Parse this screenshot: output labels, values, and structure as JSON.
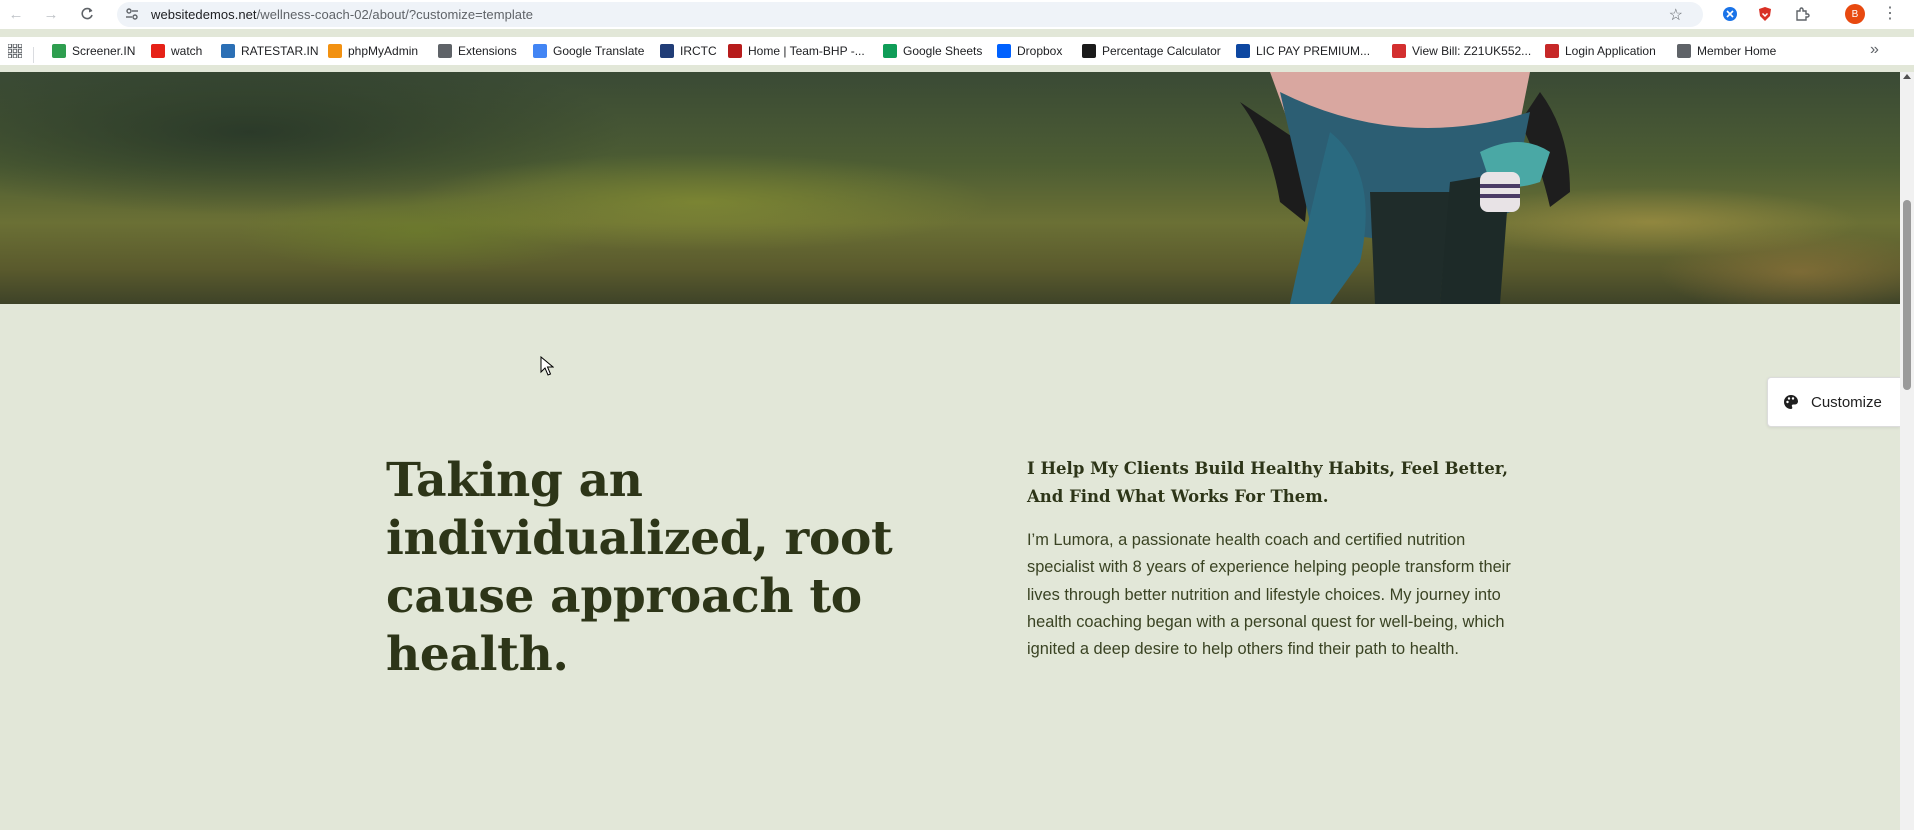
{
  "browser": {
    "url_host": "websitedemos.net",
    "url_path": "/wellness-coach-02/about/?customize=template",
    "avatar_letter": "B",
    "icons": [
      "back-icon",
      "forward-icon",
      "reload-icon",
      "site-settings-icon",
      "star-icon",
      "extension-icon",
      "menu-icon"
    ]
  },
  "bookmarks": [
    {
      "label": "Screener.IN",
      "color": "#2e9e4f"
    },
    {
      "label": "watch",
      "color": "#e62117"
    },
    {
      "label": "RATESTAR.IN",
      "color": "#2b6fb5"
    },
    {
      "label": "phpMyAdmin",
      "color": "#f29111"
    },
    {
      "label": "Extensions",
      "color": "#5f6368"
    },
    {
      "label": "Google Translate",
      "color": "#4285f4"
    },
    {
      "label": "IRCTC",
      "color": "#213d77"
    },
    {
      "label": "Home | Team-BHP -...",
      "color": "#b71c1c"
    },
    {
      "label": "Google Sheets",
      "color": "#0f9d58"
    },
    {
      "label": "Dropbox",
      "color": "#0061fe"
    },
    {
      "label": "Percentage Calculator",
      "color": "#1a1a1a"
    },
    {
      "label": "LIC PAY PREMIUM...",
      "color": "#0d47a1"
    },
    {
      "label": "View Bill: Z21UK552...",
      "color": "#d32f2f"
    },
    {
      "label": "Login Application",
      "color": "#c62828"
    },
    {
      "label": "Member Home",
      "color": "#5f6368"
    }
  ],
  "section": {
    "headline": "Taking an individualized, root cause approach to health.",
    "subheading": "I Help My Clients Build Healthy Habits, Feel Better, And Find What Works For Them.",
    "body": "I’m Lumora, a passionate health coach and certified nutrition specialist with 8 years of experience helping people transform their lives through better nutrition and lifestyle choices. My journey into health coaching began with a personal quest for well-being, which ignited a deep desire to help others find their path to health."
  },
  "customize": {
    "label": "Customize"
  },
  "colors": {
    "section_bg": "#e2e7d8",
    "heading_text": "#2d3518",
    "body_text": "#3a4323"
  }
}
